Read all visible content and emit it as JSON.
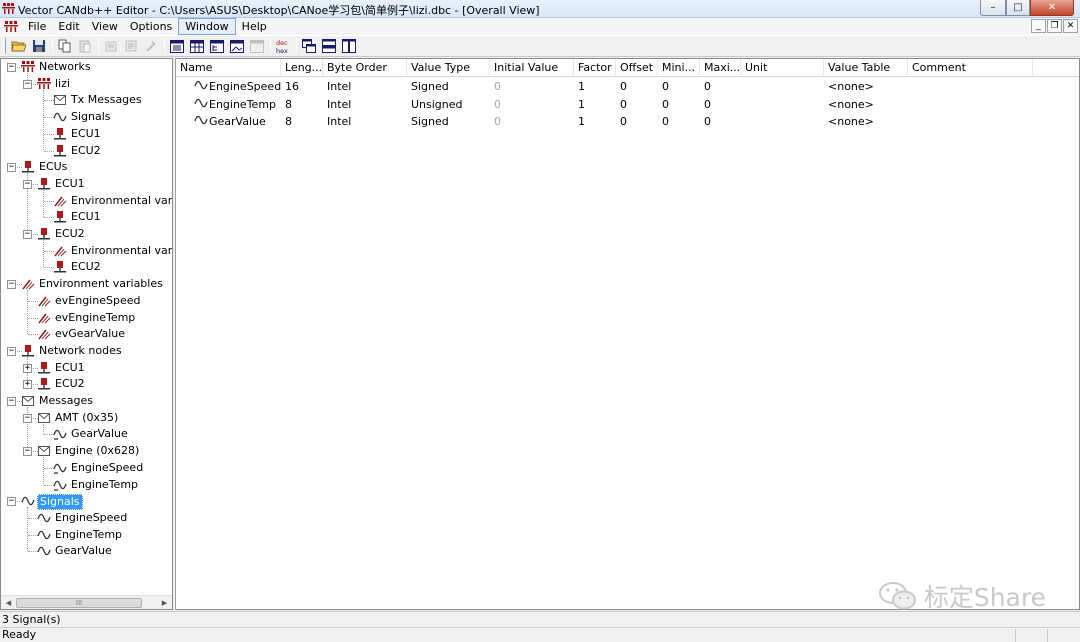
{
  "window": {
    "title": "Vector CANdb++ Editor - C:\\Users\\ASUS\\Desktop\\CANoe学习包\\简单例子\\lizi.dbc - [Overall View]",
    "minimize": "–",
    "maximize": "□",
    "close": "✕"
  },
  "menu": {
    "items": [
      "File",
      "Edit",
      "View",
      "Options",
      "Window",
      "Help"
    ],
    "mdi": [
      "_",
      "❐",
      "✕"
    ]
  },
  "tree": {
    "rows": [
      {
        "label": "Networks",
        "icon": "network-icon",
        "toggle": "−"
      },
      {
        "label": "lizi",
        "icon": "network-icon",
        "toggle": "−"
      },
      {
        "label": "Tx Messages",
        "icon": "message-icon",
        "toggle": ""
      },
      {
        "label": "Signals",
        "icon": "signal-icon",
        "toggle": ""
      },
      {
        "label": "ECU1",
        "icon": "ecu-icon",
        "toggle": ""
      },
      {
        "label": "ECU2",
        "icon": "ecu-icon",
        "toggle": ""
      },
      {
        "label": "ECUs",
        "icon": "ecu-icon",
        "toggle": "−"
      },
      {
        "label": "ECU1",
        "icon": "ecu-icon",
        "toggle": "−"
      },
      {
        "label": "Environmental variables",
        "icon": "env-var-icon",
        "toggle": ""
      },
      {
        "label": "ECU1",
        "icon": "ecu-icon",
        "toggle": ""
      },
      {
        "label": "ECU2",
        "icon": "ecu-icon",
        "toggle": "−"
      },
      {
        "label": "Environmental variables",
        "icon": "env-var-icon",
        "toggle": ""
      },
      {
        "label": "ECU2",
        "icon": "ecu-icon",
        "toggle": ""
      },
      {
        "label": "Environment variables",
        "icon": "env-var-icon",
        "toggle": "−"
      },
      {
        "label": "evEngineSpeed",
        "icon": "env-var-icon",
        "toggle": ""
      },
      {
        "label": "evEngineTemp",
        "icon": "env-var-icon",
        "toggle": ""
      },
      {
        "label": "evGearValue",
        "icon": "env-var-icon",
        "toggle": ""
      },
      {
        "label": "Network nodes",
        "icon": "ecu-icon",
        "toggle": "−"
      },
      {
        "label": "ECU1",
        "icon": "ecu-icon",
        "toggle": "+"
      },
      {
        "label": "ECU2",
        "icon": "ecu-icon",
        "toggle": "+"
      },
      {
        "label": "Messages",
        "icon": "message-icon",
        "toggle": "−"
      },
      {
        "label": "AMT (0x35)",
        "icon": "message-icon",
        "toggle": "−"
      },
      {
        "label": "GearValue",
        "icon": "mapped-signal-icon",
        "toggle": ""
      },
      {
        "label": "Engine (0x628)",
        "icon": "message-icon",
        "toggle": "−"
      },
      {
        "label": "EngineSpeed",
        "icon": "mapped-signal-icon",
        "toggle": ""
      },
      {
        "label": "EngineTemp",
        "icon": "mapped-signal-icon",
        "toggle": ""
      },
      {
        "label": "Signals",
        "icon": "signal-icon",
        "toggle": "−"
      },
      {
        "label": "EngineSpeed",
        "icon": "signal-icon",
        "toggle": ""
      },
      {
        "label": "EngineTemp",
        "icon": "signal-icon",
        "toggle": ""
      },
      {
        "label": "GearValue",
        "icon": "signal-icon",
        "toggle": ""
      }
    ],
    "scroll_left": "◀",
    "scroll_right": "▶",
    "scroll_grip": "III"
  },
  "grid": {
    "columns": [
      "Name",
      "Leng...",
      "Byte Order",
      "Value Type",
      "Initial Value",
      "Factor",
      "Offset",
      "Mini...",
      "Maxi...",
      "Unit",
      "Value Table",
      "Comment"
    ],
    "rows": [
      [
        "EngineSpeed",
        "16",
        "Intel",
        "Signed",
        "0",
        "1",
        "0",
        "0",
        "0",
        "",
        "<none>",
        ""
      ],
      [
        "EngineTemp",
        "8",
        "Intel",
        "Unsigned",
        "0",
        "1",
        "0",
        "0",
        "0",
        "",
        "<none>",
        ""
      ],
      [
        "GearValue",
        "8",
        "Intel",
        "Signed",
        "0",
        "1",
        "0",
        "0",
        "0",
        "",
        "<none>",
        ""
      ]
    ]
  },
  "watermark": {
    "text": "标定Share"
  },
  "status": {
    "count": "3 Signal(s)",
    "state": "Ready"
  },
  "colors": {
    "selection": "#3399ff",
    "ecu_red": "#b01818",
    "network_red": "#a01010"
  }
}
